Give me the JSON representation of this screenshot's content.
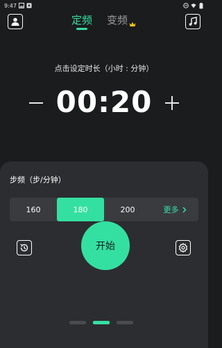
{
  "status_bar": {
    "time": "9:47"
  },
  "tabs": {
    "fixed_label": "定频",
    "variable_label": "变频"
  },
  "timer": {
    "hint": "点击设定时长（小时 : 分钟）",
    "value": "00:20"
  },
  "cadence": {
    "label": "步频（步/分钟）",
    "options": [
      "160",
      "180",
      "200"
    ],
    "selected": "180",
    "more_label": "更多"
  },
  "start_label": "开始",
  "colors": {
    "accent": "#34e0a1",
    "background": "#1b1c1e",
    "panel": "#2c2d30"
  },
  "icons": {
    "profile": "person-icon",
    "music": "music-note-icon",
    "crown": "crown-icon",
    "history": "history-icon",
    "settings": "gear-icon"
  },
  "pager": {
    "count": 3,
    "active_index": 1
  }
}
